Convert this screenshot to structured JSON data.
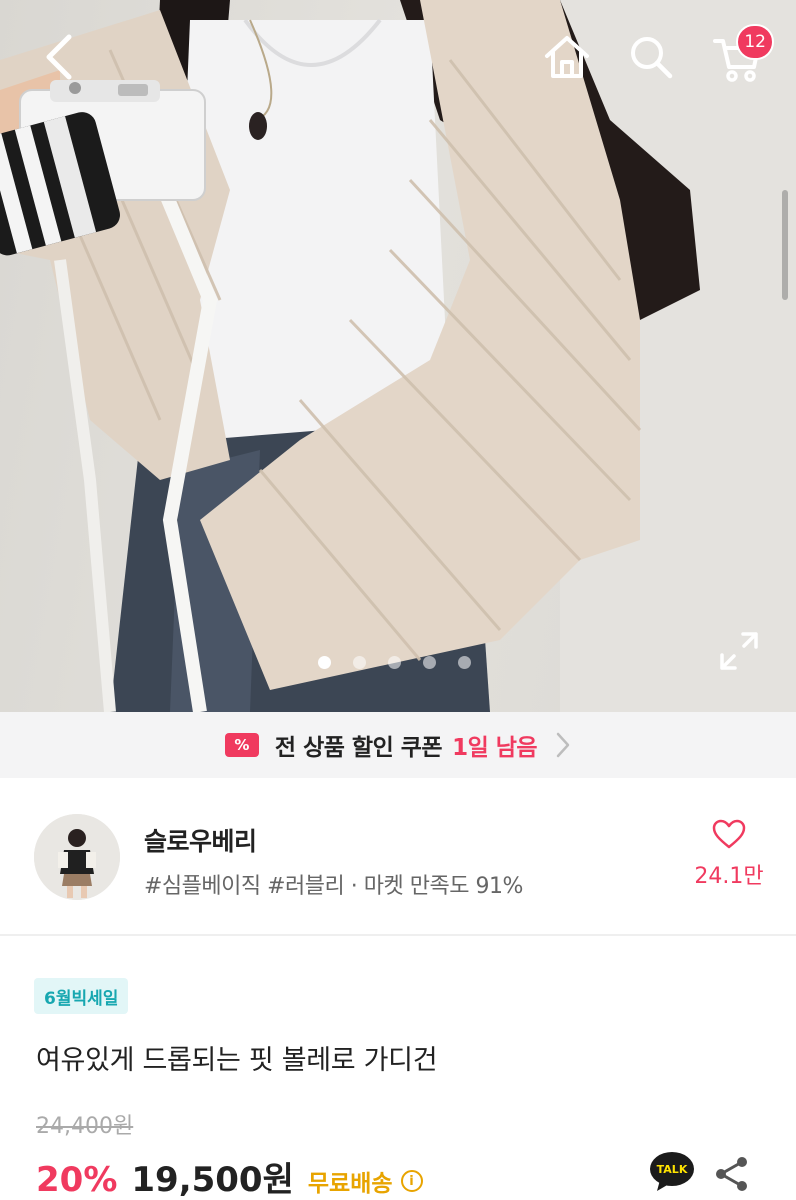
{
  "header": {
    "cart_count": "12",
    "icons": [
      "back-icon",
      "home-icon",
      "search-icon",
      "cart-icon",
      "expand-icon"
    ]
  },
  "carousel": {
    "total": 5,
    "active": 1
  },
  "coupon": {
    "icon_text": "%",
    "text": "전 상품 할인 쿠폰",
    "highlight": "1일 남음"
  },
  "shop": {
    "name": "슬로우베리",
    "meta": "#심플베이직 #러블리 · 마켓 만족도 91%",
    "likes": "24.1만"
  },
  "product": {
    "tag": "6월빅세일",
    "title": "여유있게 드롭되는 핏 볼레로 가디건",
    "original_price": "24,400원",
    "discount": "20%",
    "price": "19,500원",
    "shipping": "무료배송",
    "talk_label": "TALK"
  },
  "colors": {
    "accent": "#f03a5f",
    "tag_bg": "#e2f6f7",
    "tag_text": "#17a7b0",
    "shipping": "#e8a400"
  }
}
